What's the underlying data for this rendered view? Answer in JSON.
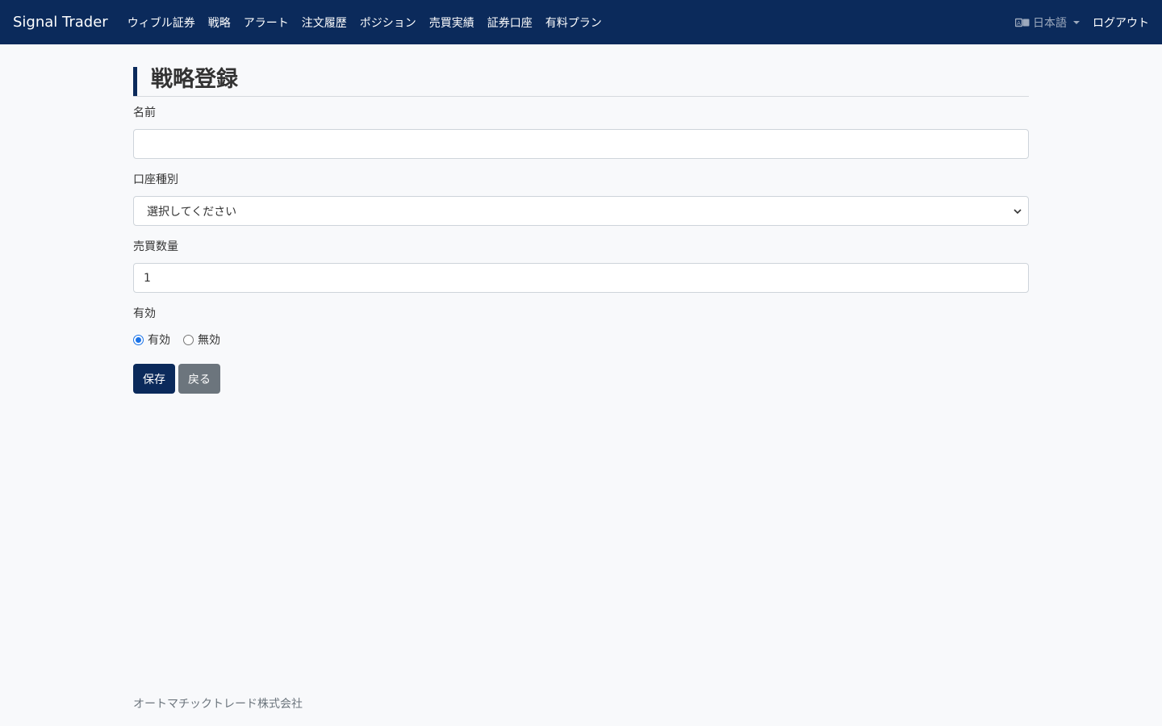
{
  "navbar": {
    "brand": "Signal Trader",
    "links": [
      "ウィブル証券",
      "戦略",
      "アラート",
      "注文履歴",
      "ポジション",
      "売買実績",
      "証券口座",
      "有料プラン"
    ],
    "language": "日本語",
    "logout": "ログアウト"
  },
  "page": {
    "title": "戦略登録"
  },
  "form": {
    "name_label": "名前",
    "name_value": "",
    "account_type_label": "口座種別",
    "account_type_selected": "選択してください",
    "quantity_label": "売買数量",
    "quantity_value": "1",
    "enabled_label": "有効",
    "radio_enabled": "有効",
    "radio_disabled": "無効",
    "save_button": "保存",
    "back_button": "戻る"
  },
  "footer": {
    "company": "オートマチックトレード株式会社"
  },
  "colors": {
    "navbar": "#0b2a5b",
    "primary": "#0b2a5b",
    "secondary": "#6c757d",
    "radio_checked": "#1a73e8"
  }
}
